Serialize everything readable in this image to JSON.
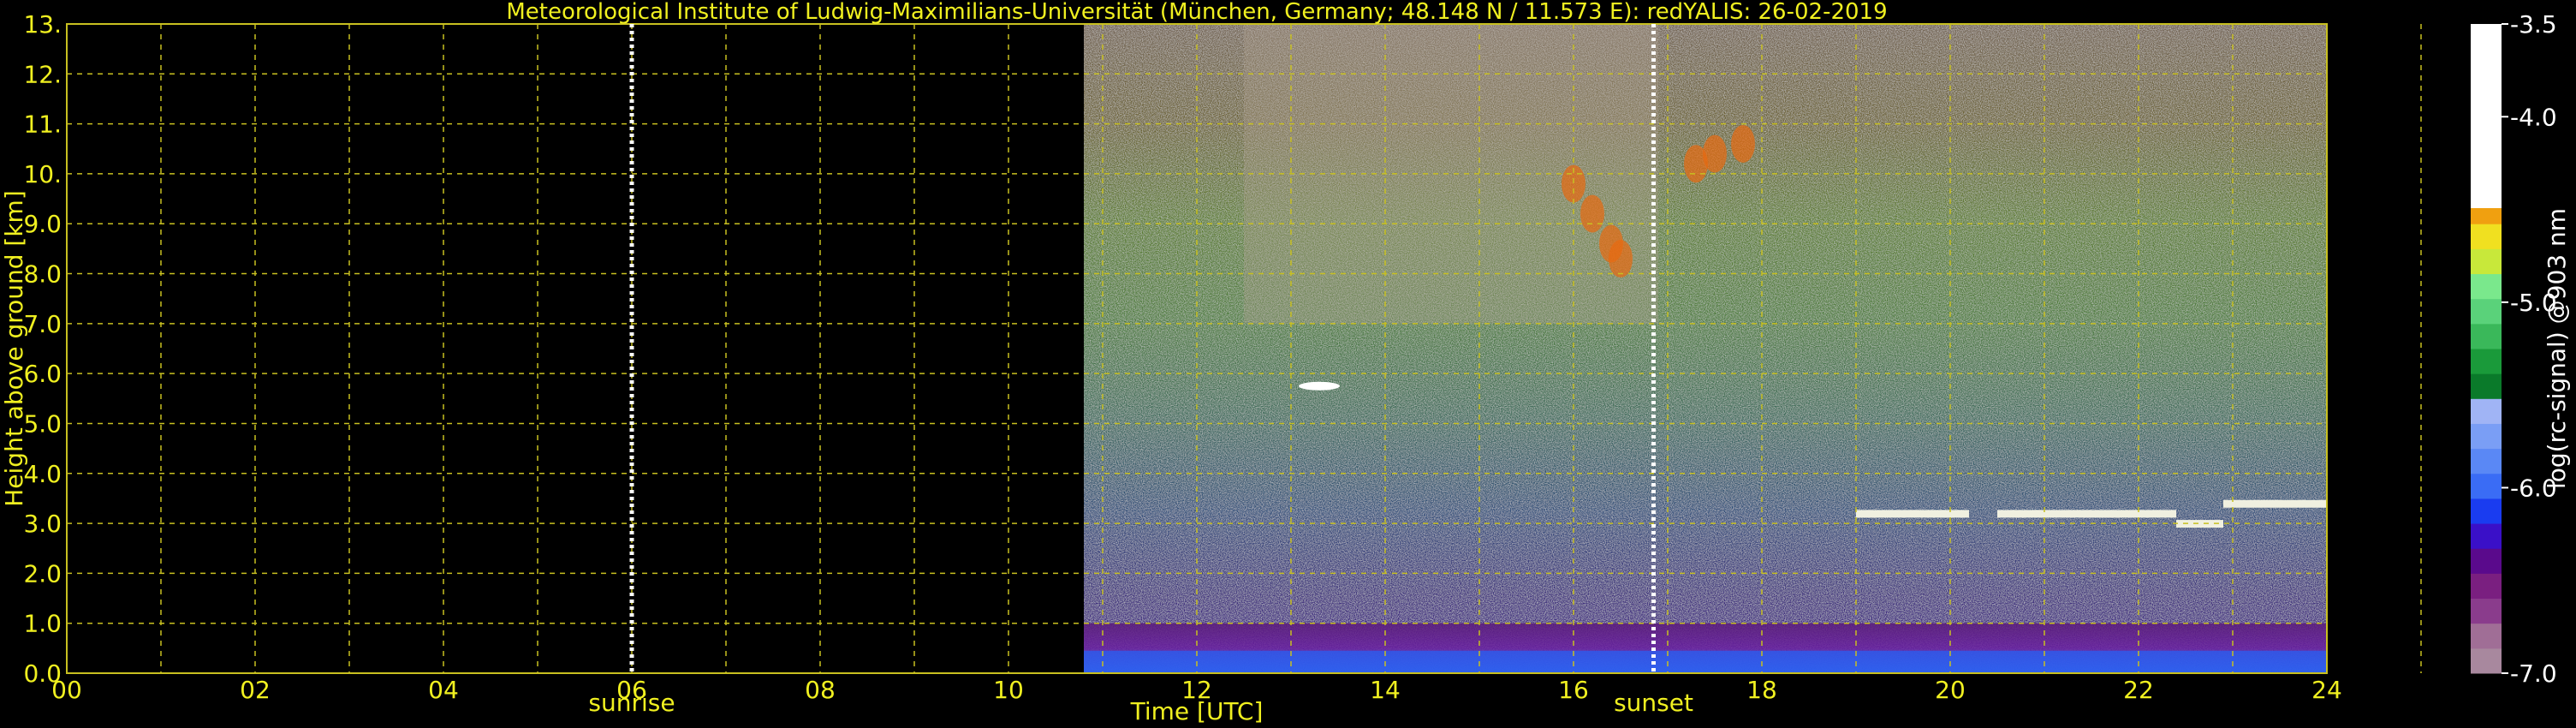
{
  "chart_data": {
    "type": "heatmap",
    "title": "Meteorological Institute of Ludwig-Maximilians-Universität (München, Germany; 48.148 N / 11.573 E):    redYALIS: 26-02-2019",
    "xlabel": "Time [UTC]",
    "ylabel": "Height above ground [km]",
    "xlim": [
      0,
      24
    ],
    "ylim": [
      0,
      13
    ],
    "x_ticks": [
      "00",
      "02",
      "04",
      "06",
      "08",
      "10",
      "12",
      "14",
      "16",
      "18",
      "20",
      "22",
      "24"
    ],
    "y_ticks": [
      "0.0",
      "1.0",
      "2.0",
      "3.0",
      "4.0",
      "5.0",
      "6.0",
      "7.0",
      "8.0",
      "9.0",
      "10.",
      "11.",
      "12.",
      "13."
    ],
    "grid": true,
    "data_start_hour": 10.8,
    "markers": [
      {
        "label": "sunrise",
        "x": 6.0
      },
      {
        "label": "sunset",
        "x": 16.85
      }
    ],
    "colorbar": {
      "label": "log(rc-signal) @903 nm",
      "range": [
        -7.0,
        -3.5
      ],
      "ticks": [
        "-3.5",
        "-4.0",
        "-5.0",
        "-6.0",
        "-7.0"
      ],
      "colors": [
        "#a8889e",
        "#a06e96",
        "#8a3c8c",
        "#7a1f80",
        "#5a0a8c",
        "#3a10c8",
        "#1a3cf0",
        "#3a6cf5",
        "#5a88f5",
        "#7a9ef5",
        "#a0b4f5",
        "#0a7a2a",
        "#1a9a3a",
        "#3ab85a",
        "#5ad27a",
        "#7ae88c",
        "#c8e83a",
        "#f0e020",
        "#f0a010",
        "#e86a10",
        "#e82010",
        "#c80a0a",
        "#e8a8a8",
        "#f0c8c8",
        "#f5e0e0",
        "#ffffff"
      ]
    }
  }
}
